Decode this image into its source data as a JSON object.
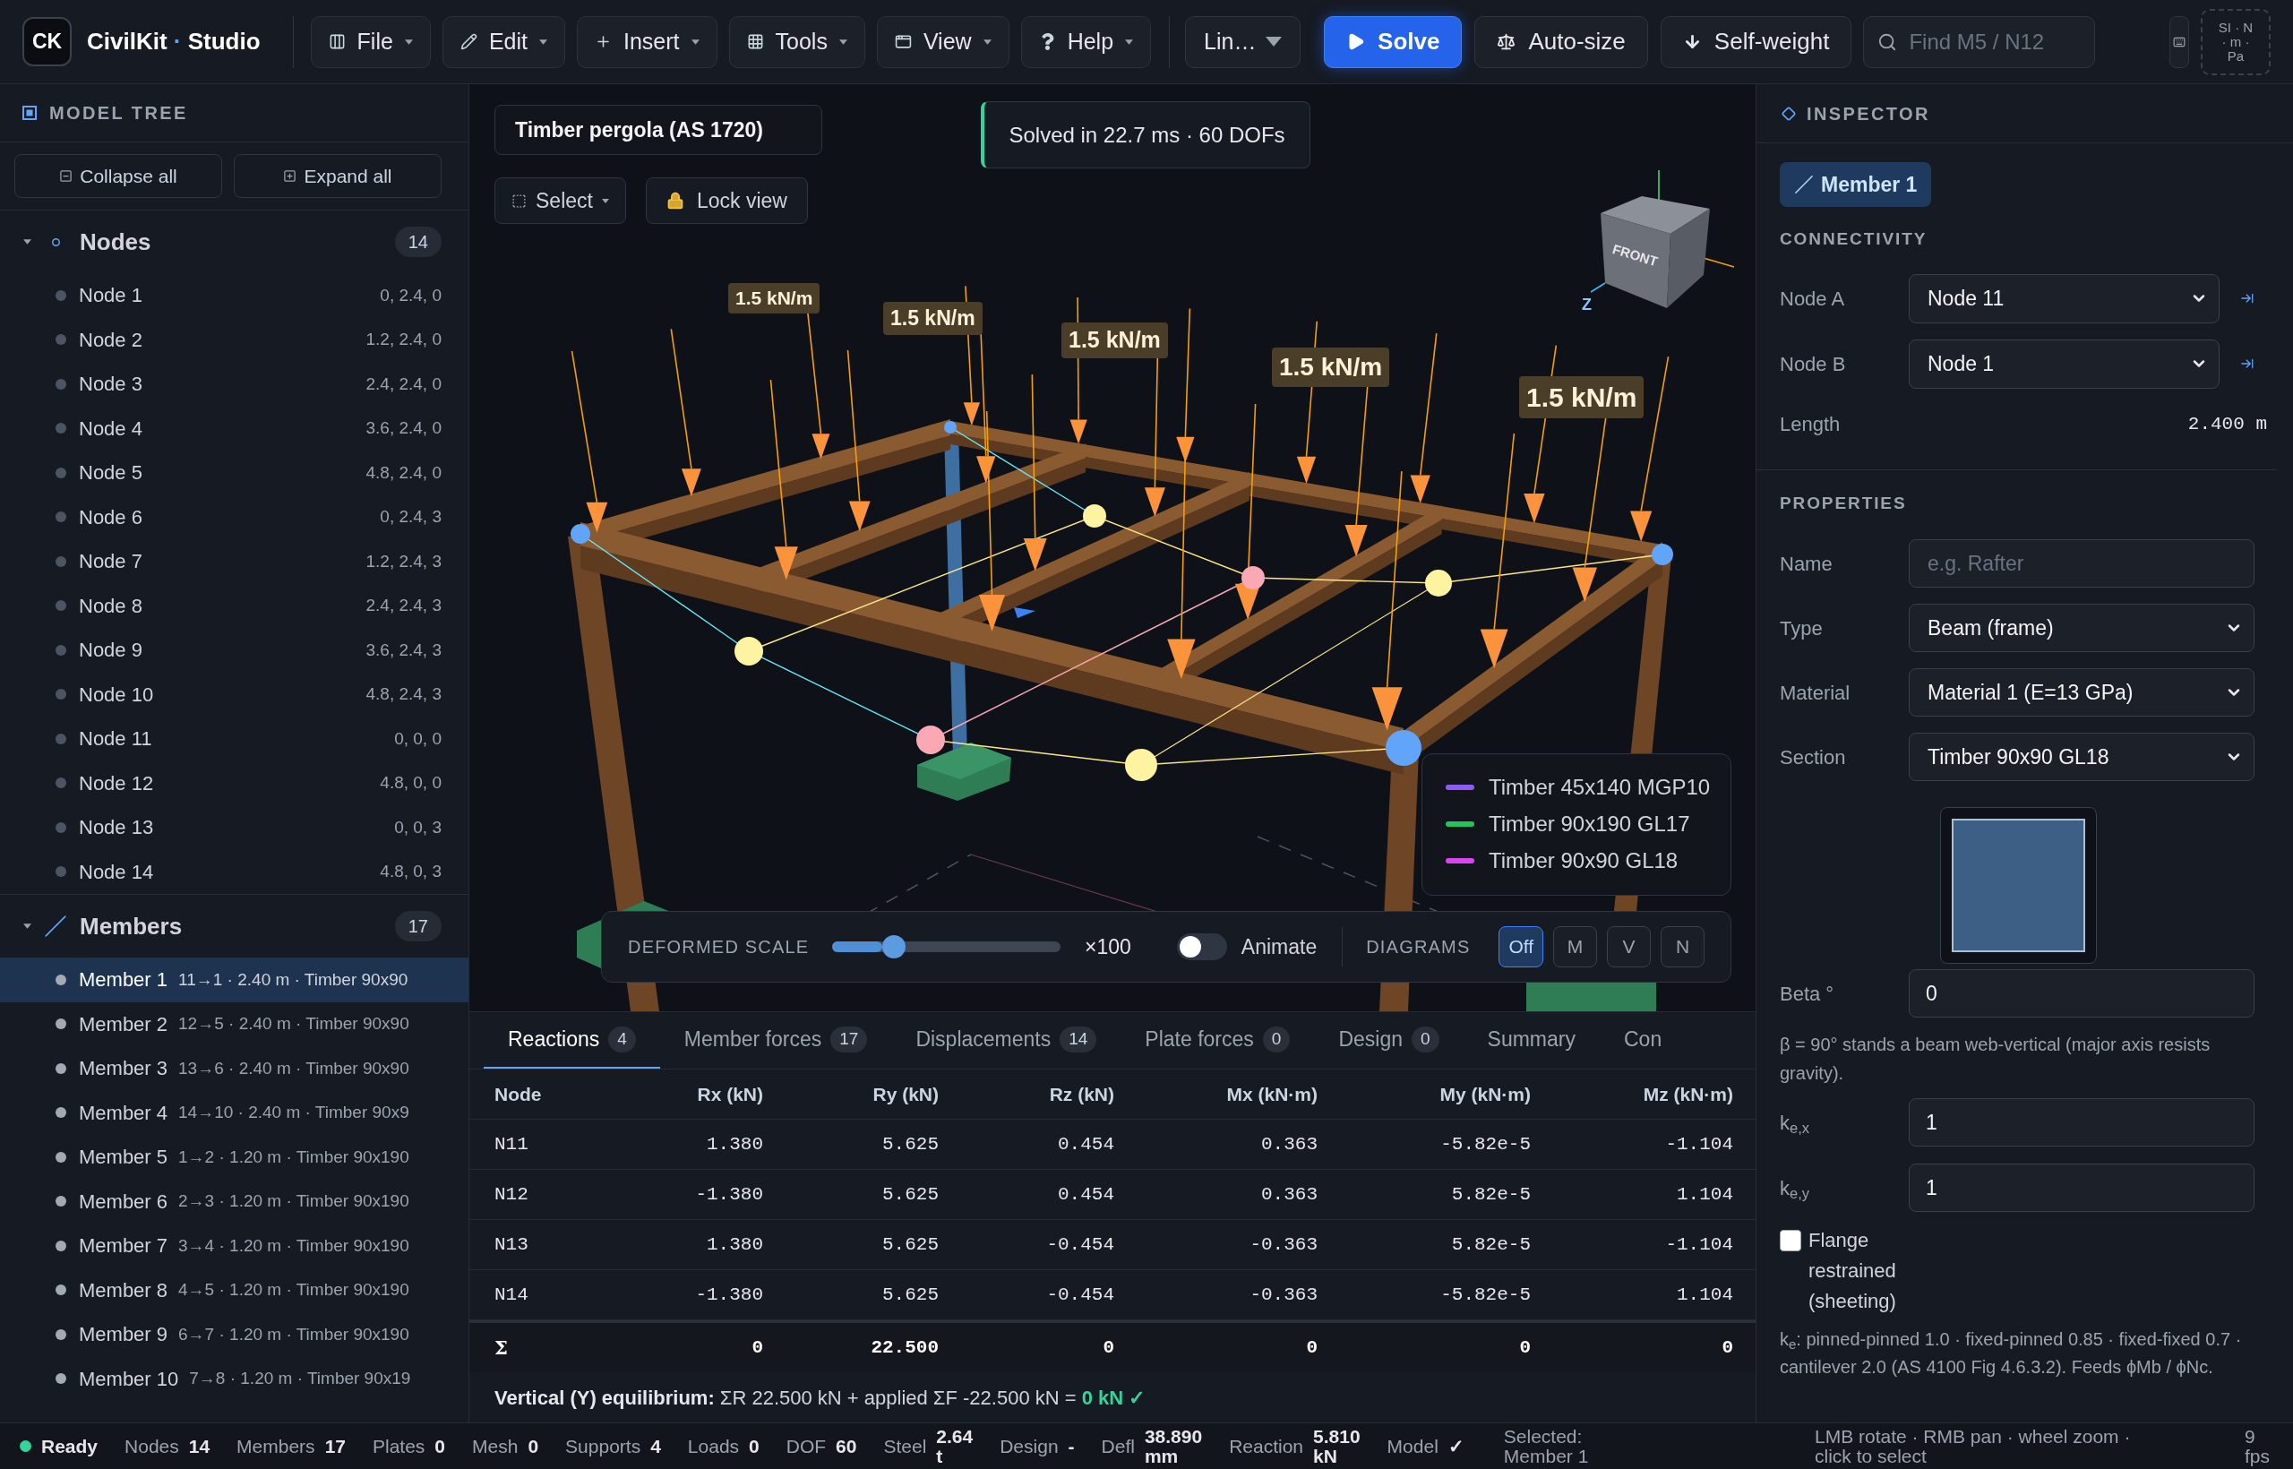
{
  "toolbar": {
    "logo": "CK",
    "brand": {
      "name": "CivilKit",
      "separator": "·",
      "suffix": "Studio"
    },
    "menus": [
      "File",
      "Edit",
      "Insert",
      "Tools",
      "View",
      "Help"
    ],
    "analysis": "Lin…",
    "actions": [
      {
        "kind": "solve",
        "label": "Solve"
      },
      {
        "kind": "autosize",
        "label": "Auto-size"
      },
      {
        "kind": "selfweight",
        "label": "Self-weight"
      }
    ],
    "search": {
      "placeholder": "Find M5 / N12"
    },
    "units": "SI · N · m · Pa"
  },
  "sidebar": {
    "title": "MODEL TREE",
    "buttons": [
      "Collapse all",
      "Expand all"
    ],
    "groups": [
      {
        "kind": "nodes",
        "label": "Nodes",
        "count": "14",
        "expanded": true,
        "children": [
          {
            "label": "Node 1",
            "detail": "0, 2.4, 0",
            "selected": false
          },
          {
            "label": "Node 2",
            "detail": "1.2, 2.4, 0",
            "selected": false
          },
          {
            "label": "Node 3",
            "detail": "2.4, 2.4, 0",
            "selected": false
          },
          {
            "label": "Node 4",
            "detail": "3.6, 2.4, 0",
            "selected": false
          },
          {
            "label": "Node 5",
            "detail": "4.8, 2.4, 0",
            "selected": false
          },
          {
            "label": "Node 6",
            "detail": "0, 2.4, 3",
            "selected": false
          },
          {
            "label": "Node 7",
            "detail": "1.2, 2.4, 3",
            "selected": false
          },
          {
            "label": "Node 8",
            "detail": "2.4, 2.4, 3",
            "selected": false
          },
          {
            "label": "Node 9",
            "detail": "3.6, 2.4, 3",
            "selected": false
          },
          {
            "label": "Node 10",
            "detail": "4.8, 2.4, 3",
            "selected": false
          },
          {
            "label": "Node 11",
            "detail": "0, 0, 0",
            "selected": false
          },
          {
            "label": "Node 12",
            "detail": "4.8, 0, 0",
            "selected": false
          },
          {
            "label": "Node 13",
            "detail": "0, 0, 3",
            "selected": false
          },
          {
            "label": "Node 14",
            "detail": "4.8, 0, 3",
            "selected": false
          }
        ]
      },
      {
        "kind": "members",
        "label": "Members",
        "count": "17",
        "expanded": true,
        "children": [
          {
            "label": "Member 1",
            "detail": "11→1 · 2.40 m · Timber 90x90",
            "selected": true
          },
          {
            "label": "Member 2",
            "detail": "12→5 · 2.40 m · Timber 90x90",
            "selected": false
          },
          {
            "label": "Member 3",
            "detail": "13→6 · 2.40 m · Timber 90x90",
            "selected": false
          },
          {
            "label": "Member 4",
            "detail": "14→10 · 2.40 m · Timber 90x9",
            "selected": false
          },
          {
            "label": "Member 5",
            "detail": "1→2 · 1.20 m · Timber 90x190",
            "selected": false
          },
          {
            "label": "Member 6",
            "detail": "2→3 · 1.20 m · Timber 90x190",
            "selected": false
          },
          {
            "label": "Member 7",
            "detail": "3→4 · 1.20 m · Timber 90x190",
            "selected": false
          },
          {
            "label": "Member 8",
            "detail": "4→5 · 1.20 m · Timber 90x190",
            "selected": false
          },
          {
            "label": "Member 9",
            "detail": "6→7 · 1.20 m · Timber 90x190",
            "selected": false
          },
          {
            "label": "Member 10",
            "detail": "7→8 · 1.20 m · Timber 90x19",
            "selected": false
          }
        ]
      }
    ]
  },
  "viewport": {
    "title": "Timber pergola (AS 1720)",
    "select": "Select",
    "lock": "Lock view",
    "toast": "Solved in 22.7 ms · 60 DOFs",
    "cube": {
      "face": "FRONT",
      "axis": "Z"
    },
    "load_labels": [
      "1.5 kN/m",
      "1.5 kN/m",
      "1.5 kN/m",
      "1.5 kN/m",
      "1.5 kN/m"
    ],
    "legend": [
      {
        "label": "Timber 45x140 MGP10",
        "color": "#8b5cf6"
      },
      {
        "label": "Timber 90x190 GL17",
        "color": "#22c55e"
      },
      {
        "label": "Timber 90x90 GL18",
        "color": "#d946ef"
      }
    ],
    "controls": {
      "deformed_scale": {
        "label": "DEFORMED SCALE",
        "level": 0.27,
        "reading": "×100"
      },
      "animate": {
        "label": "Animate",
        "on": false
      },
      "diagrams_label": "DIAGRAMS",
      "diagrams": [
        {
          "label": "Off",
          "selected": true
        },
        {
          "label": "M",
          "selected": false
        },
        {
          "label": "V",
          "selected": false
        },
        {
          "label": "N",
          "selected": false
        }
      ]
    }
  },
  "results": {
    "tabs": [
      {
        "label": "Reactions",
        "count": "4",
        "selected": true
      },
      {
        "label": "Member forces",
        "count": "17",
        "selected": false
      },
      {
        "label": "Displacements",
        "count": "14",
        "selected": false
      },
      {
        "label": "Plate forces",
        "count": "0",
        "selected": false
      },
      {
        "label": "Design",
        "count": "0",
        "selected": false
      },
      {
        "label": "Summary",
        "selected": false
      },
      {
        "label": "Con",
        "selected": false
      }
    ],
    "columns": [
      "Node",
      "Rx (kN)",
      "Ry (kN)",
      "Rz (kN)",
      "Mx (kN·m)",
      "My (kN·m)",
      "Mz (kN·m)"
    ],
    "rows": [
      [
        "N11",
        "1.380",
        "5.625",
        "0.454",
        "0.363",
        "-5.82e-5",
        "-1.104"
      ],
      [
        "N12",
        "-1.380",
        "5.625",
        "0.454",
        "0.363",
        "5.82e-5",
        "1.104"
      ],
      [
        "N13",
        "1.380",
        "5.625",
        "-0.454",
        "-0.363",
        "5.82e-5",
        "-1.104"
      ],
      [
        "N14",
        "-1.380",
        "5.625",
        "-0.454",
        "-0.363",
        "-5.82e-5",
        "1.104"
      ]
    ],
    "total": [
      "Σ",
      "0",
      "22.500",
      "0",
      "0",
      "0",
      "0"
    ],
    "equilibrium": {
      "label": "Vertical (Y) equilibrium:",
      "expression": "ΣR 22.500 kN + applied ΣF -22.500 kN =",
      "result": "0 kN ✓"
    }
  },
  "inspector": {
    "title": "INSPECTOR",
    "selection": "Member 1",
    "connectivity": {
      "heading": "CONNECTIVITY",
      "nodes": [
        {
          "label": "Node A",
          "value": "Node 11"
        },
        {
          "label": "Node B",
          "value": "Node 1"
        }
      ],
      "length": {
        "label": "Length",
        "value": "2.400 m"
      }
    },
    "properties": {
      "heading": "PROPERTIES",
      "fields": [
        {
          "kind": "text",
          "label": "Name",
          "placeholder": "e.g. Rafter"
        },
        {
          "kind": "select",
          "label": "Type",
          "value": "Beam (frame)"
        },
        {
          "kind": "select",
          "label": "Material",
          "value": "Material 1 (E=13 GPa)"
        },
        {
          "kind": "select",
          "label": "Section",
          "value": "Timber 90x90 GL18"
        }
      ],
      "beta": {
        "label": "Beta °",
        "value": "0"
      },
      "beta_note": "β = 90° stands a beam web-vertical (major axis resists gravity).",
      "factors": [
        {
          "label": "k$_{e,x}$",
          "value": "1"
        },
        {
          "label": "k$_{e,y}$",
          "value": "1"
        }
      ],
      "flange": {
        "label": "Flange restrained (sheeting)",
        "checked": false
      },
      "footnote": "k$_{e}$: pinned-pinned 1.0 · fixed-pinned 0.85 · fixed-fixed 0.7 · cantilever 2.0 (AS 4100 Fig 4.6.3.2). Feeds ϕMb / ϕNc."
    }
  },
  "status_bar": {
    "state": {
      "label": "Ready",
      "color": "#34d399"
    },
    "stats": [
      {
        "label": "Nodes",
        "value": "14"
      },
      {
        "label": "Members",
        "value": "17"
      },
      {
        "label": "Plates",
        "value": "0"
      },
      {
        "label": "Mesh",
        "value": "0"
      },
      {
        "label": "Supports",
        "value": "4"
      },
      {
        "label": "Loads",
        "value": "0"
      },
      {
        "label": "DOF",
        "value": "60"
      },
      {
        "label": "Steel",
        "value": "2.64 t"
      },
      {
        "label": "Design",
        "value": "-"
      },
      {
        "label": "Defl",
        "value": "38.890 mm"
      },
      {
        "label": "Reaction",
        "value": "5.810 kN"
      },
      {
        "label": "Model",
        "value": "✓"
      }
    ],
    "selection": "Selected: Member 1",
    "hint": "LMB rotate · RMB pan · wheel zoom · click to select",
    "fps": "9 fps"
  }
}
